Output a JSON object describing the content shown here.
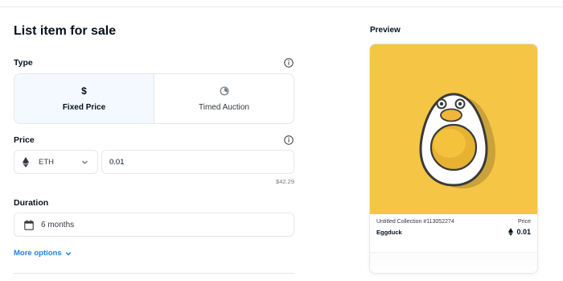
{
  "form": {
    "title": "List item for sale",
    "type": {
      "label": "Type",
      "options": [
        {
          "label": "Fixed Price",
          "icon": "dollar-icon",
          "selected": true
        },
        {
          "label": "Timed Auction",
          "icon": "timer-icon",
          "selected": false
        }
      ],
      "dollar_glyph": "$"
    },
    "price": {
      "label": "Price",
      "currency": "ETH",
      "value": "0.01",
      "usd_value": "$42.29"
    },
    "duration": {
      "label": "Duration",
      "value": "6 months"
    },
    "more_options_label": "More options"
  },
  "preview": {
    "label": "Preview",
    "card": {
      "collection": "Untitled Collection #113052274",
      "name": "Eggduck",
      "price_label": "Price",
      "price_value": "0.01",
      "image_bg": "#f5c545"
    }
  },
  "colors": {
    "accent": "#2081e2",
    "selected_bg": "#f3f9fe",
    "border": "#e5e8eb"
  }
}
